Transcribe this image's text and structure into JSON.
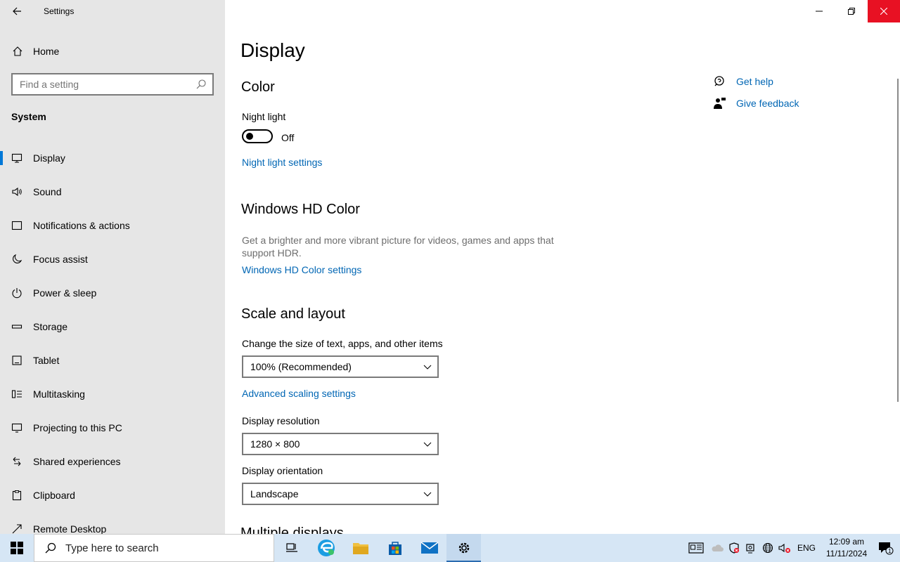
{
  "window": {
    "app_title": "Settings"
  },
  "sidebar": {
    "home_label": "Home",
    "search_placeholder": "Find a setting",
    "section_label": "System",
    "items": [
      {
        "label": "Display",
        "icon": "monitor-icon",
        "active": true
      },
      {
        "label": "Sound",
        "icon": "speaker-icon"
      },
      {
        "label": "Notifications & actions",
        "icon": "notification-icon"
      },
      {
        "label": "Focus assist",
        "icon": "moon-icon"
      },
      {
        "label": "Power & sleep",
        "icon": "power-icon"
      },
      {
        "label": "Storage",
        "icon": "storage-icon"
      },
      {
        "label": "Tablet",
        "icon": "tablet-icon"
      },
      {
        "label": "Multitasking",
        "icon": "multitasking-icon"
      },
      {
        "label": "Projecting to this PC",
        "icon": "projecting-icon"
      },
      {
        "label": "Shared experiences",
        "icon": "shared-icon"
      },
      {
        "label": "Clipboard",
        "icon": "clipboard-icon"
      },
      {
        "label": "Remote Desktop",
        "icon": "remote-desktop-icon"
      }
    ]
  },
  "main": {
    "page_title": "Display",
    "color": {
      "heading": "Color",
      "night_light_label": "Night light",
      "night_light_state": "Off",
      "night_light_on": false,
      "night_light_link": "Night light settings"
    },
    "hdr": {
      "heading": "Windows HD Color",
      "description": "Get a brighter and more vibrant picture for videos, games and apps that support HDR.",
      "link": "Windows HD Color settings"
    },
    "scale": {
      "heading": "Scale and layout",
      "size_label": "Change the size of text, apps, and other items",
      "size_value": "100% (Recommended)",
      "advanced_link": "Advanced scaling settings",
      "resolution_label": "Display resolution",
      "resolution_value": "1280 × 800",
      "orientation_label": "Display orientation",
      "orientation_value": "Landscape"
    },
    "next_heading": "Multiple displays",
    "help": {
      "get_help": "Get help",
      "give_feedback": "Give feedback"
    }
  },
  "taskbar": {
    "search_placeholder": "Type here to search",
    "language": "ENG",
    "time": "12:09 am",
    "date": "11/11/2024",
    "notification_count": "1"
  },
  "colors": {
    "accent": "#0078d7",
    "link": "#0066b4",
    "close_hover": "#e81123",
    "sidebar_bg": "#e6e6e6",
    "taskbar_bg": "#d6e6f5"
  }
}
